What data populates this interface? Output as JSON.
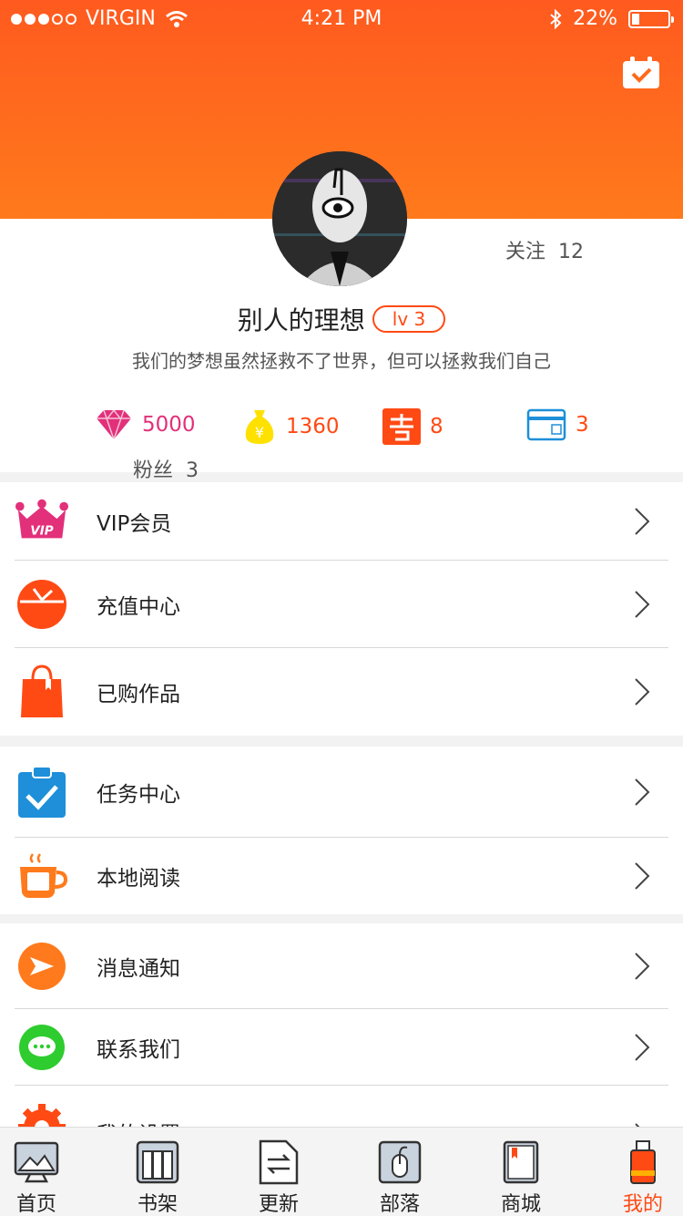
{
  "status_bar": {
    "carrier": "VIRGIN",
    "time": "4:21 PM",
    "battery": "22%",
    "battery_level": 0.22
  },
  "header": {
    "checkin_icon": "calendar-check-icon"
  },
  "profile": {
    "fans_label": "粉丝",
    "fans_count": "3",
    "follow_label": "关注",
    "follow_count": "12",
    "username": "别人的理想",
    "level": "lv 3",
    "signature": "我们的梦想虽然拯救不了世界，但可以拯救我们自己"
  },
  "assets": [
    {
      "icon": "diamond-icon",
      "value": "5000"
    },
    {
      "icon": "money-bag-icon",
      "value": "1360"
    },
    {
      "icon": "coupon-icon",
      "value": "8"
    },
    {
      "icon": "monthly-card-icon",
      "value": "3"
    }
  ],
  "menu_groups": [
    [
      {
        "icon": "vip-crown-icon",
        "label": "VIP会员"
      },
      {
        "icon": "recharge-icon",
        "label": "充值中心"
      },
      {
        "icon": "shopping-bag-icon",
        "label": "已购作品"
      }
    ],
    [
      {
        "icon": "task-clipboard-icon",
        "label": "任务中心"
      },
      {
        "icon": "coffee-cup-icon",
        "label": "本地阅读"
      }
    ],
    [
      {
        "icon": "notification-icon",
        "label": "消息通知"
      },
      {
        "icon": "chat-bubble-icon",
        "label": "联系我们"
      },
      {
        "icon": "gear-icon",
        "label": "我的设置"
      }
    ]
  ],
  "tabbar": [
    {
      "icon": "home-icon",
      "label": "首页"
    },
    {
      "icon": "bookshelf-icon",
      "label": "书架"
    },
    {
      "icon": "update-icon",
      "label": "更新"
    },
    {
      "icon": "tribe-icon",
      "label": "部落"
    },
    {
      "icon": "store-icon",
      "label": "商城"
    },
    {
      "icon": "profile-icon",
      "label": "我的",
      "active": true
    }
  ],
  "colors": {
    "accent": "#ff4a14",
    "header_top": "#ff5a1f",
    "header_bottom": "#ff7a1c"
  }
}
